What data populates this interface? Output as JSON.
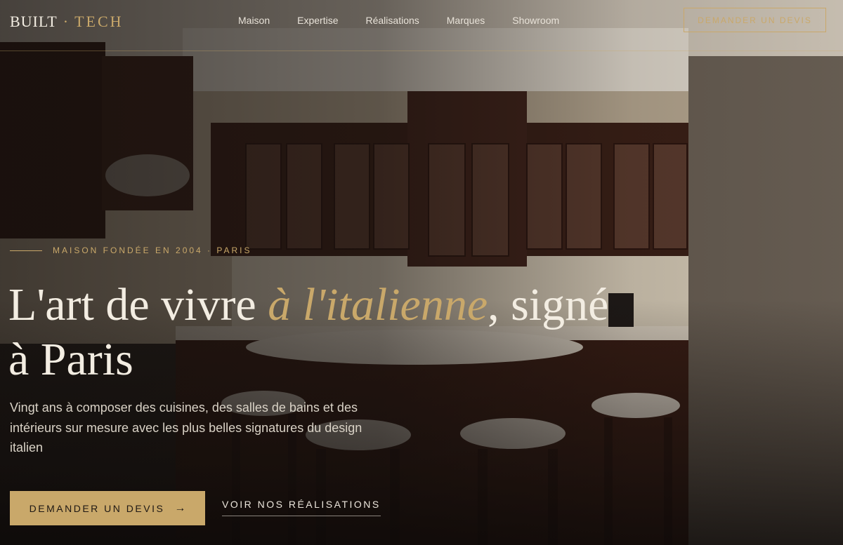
{
  "header": {
    "logo_left": "BUILT",
    "logo_sep": "·",
    "logo_right": "TECH",
    "nav": [
      "Maison",
      "Expertise",
      "Réalisations",
      "Marques",
      "Showroom"
    ],
    "cta_label": "DEMANDER UN DEVIS"
  },
  "hero": {
    "eyebrow": "MAISON FONDÉE EN 2004 · PARIS",
    "title_part1": "L'art de vivre ",
    "title_accent": "à l'italienne",
    "title_part2": ", signé à Paris",
    "lead": "Vingt ans à composer des cuisines, des salles de bains et des intérieurs sur mesure avec les plus belles signatures du design italien",
    "primary_cta": "DEMANDER UN DEVIS",
    "primary_cta_icon": "arrow-right-icon",
    "secondary_cta": "VOIR NOS RÉALISATIONS"
  },
  "colors": {
    "accent": "#c9a86a",
    "text_light": "#f3ede2",
    "background_dark": "#1e1814"
  }
}
